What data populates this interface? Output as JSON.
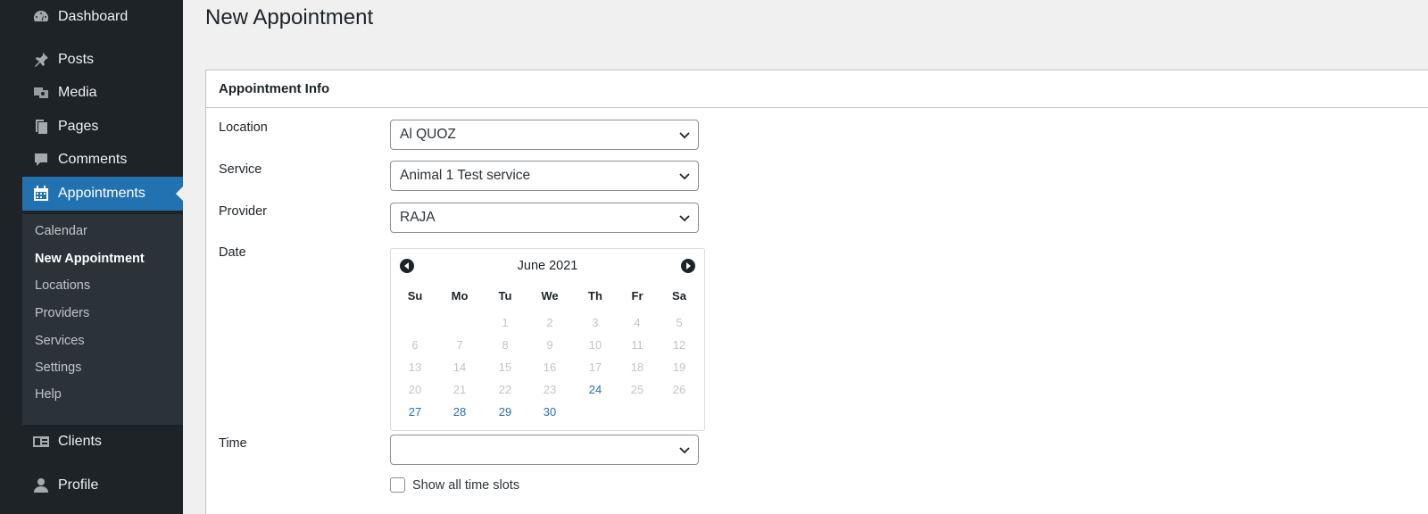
{
  "sidebar": {
    "menu": [
      {
        "id": "dashboard",
        "label": "Dashboard",
        "icon": "dashboard-icon"
      },
      {
        "id": "posts",
        "label": "Posts",
        "icon": "pin-icon"
      },
      {
        "id": "media",
        "label": "Media",
        "icon": "media-icon"
      },
      {
        "id": "pages",
        "label": "Pages",
        "icon": "pages-icon"
      },
      {
        "id": "comments",
        "label": "Comments",
        "icon": "comment-icon"
      },
      {
        "id": "appointments",
        "label": "Appointments",
        "icon": "calendar-icon",
        "active": true
      },
      {
        "id": "clients",
        "label": "Clients",
        "icon": "id-card-icon"
      },
      {
        "id": "profile",
        "label": "Profile",
        "icon": "user-icon"
      }
    ],
    "submenu": [
      "Calendar",
      "New Appointment",
      "Locations",
      "Providers",
      "Services",
      "Settings",
      "Help"
    ],
    "submenu_current": "New Appointment"
  },
  "page": {
    "title": "New Appointment"
  },
  "panel": {
    "title": "Appointment Info",
    "fields": {
      "location": {
        "label": "Location",
        "value": "Al QUOZ"
      },
      "service": {
        "label": "Service",
        "value": "Animal 1 Test service"
      },
      "provider": {
        "label": "Provider",
        "value": "RAJA"
      },
      "date": {
        "label": "Date"
      },
      "time": {
        "label": "Time",
        "value": ""
      }
    },
    "show_all_label": "Show all time slots",
    "show_all_checked": false
  },
  "calendar": {
    "month_label": "June 2021",
    "weekdays": [
      "Su",
      "Mo",
      "Tu",
      "We",
      "Th",
      "Fr",
      "Sa"
    ],
    "first_weekday_index": 2,
    "days_in_month": 30,
    "available_days": [
      24,
      27,
      28,
      29,
      30
    ]
  },
  "colors": {
    "sidebar_bg": "#1d2327",
    "accent": "#2271b1",
    "available_day": "#2271b1",
    "unavailable_day": "#c3c4c7"
  }
}
